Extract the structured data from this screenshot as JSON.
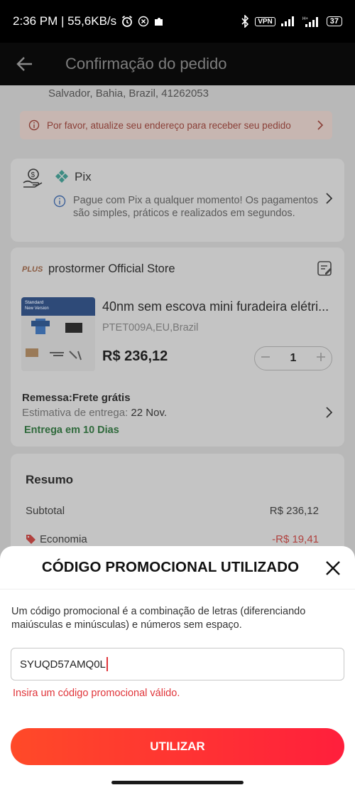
{
  "status_bar": {
    "time_speed": "2:36 PM | 55,6KB/s",
    "vpn": "VPN",
    "battery": "37"
  },
  "header": {
    "title": "Confirmação do pedido"
  },
  "address": {
    "text": "Salvador, Bahia, Brazil, 41262053",
    "warning": "Por favor, atualize seu endereço para receber seu pedido"
  },
  "payment": {
    "method": "Pix",
    "info": "Pague com Pix a qualquer momento! Os pagamentos são simples, práticos e realizados em segundos."
  },
  "store": {
    "logo_text": "PLUS",
    "name": "prostormer Official Store"
  },
  "product": {
    "title": "40nm sem escova mini furadeira elétri...",
    "variant": "PTET009A,EU,Brazil",
    "price": "R$ 236,12",
    "quantity": "1",
    "thumb_text_1": "Standard",
    "thumb_text_2": "New Version"
  },
  "shipping": {
    "label": "Remessa:Frete grátis",
    "estimate_label": "Estimativa de entrega:",
    "estimate_date": "22 Nov.",
    "delivery": "Entrega em 10 Dias"
  },
  "summary": {
    "title": "Resumo",
    "subtotal_label": "Subtotal",
    "subtotal_value": "R$ 236,12",
    "economy_label": "Economia",
    "economy_value": "-R$ 19,41"
  },
  "modal": {
    "title": "CÓDIGO PROMOCIONAL UTILIZADO",
    "description": "Um código promocional é a combinação de letras (diferenciando maiúsculas e minúsculas) e números sem espaço.",
    "input_value": "SYUQD57AMQ0L",
    "error": "Insira um código promocional válido.",
    "button": "UTILIZAR"
  },
  "colors": {
    "accent": "#ff2d37",
    "error": "#e0353a"
  }
}
